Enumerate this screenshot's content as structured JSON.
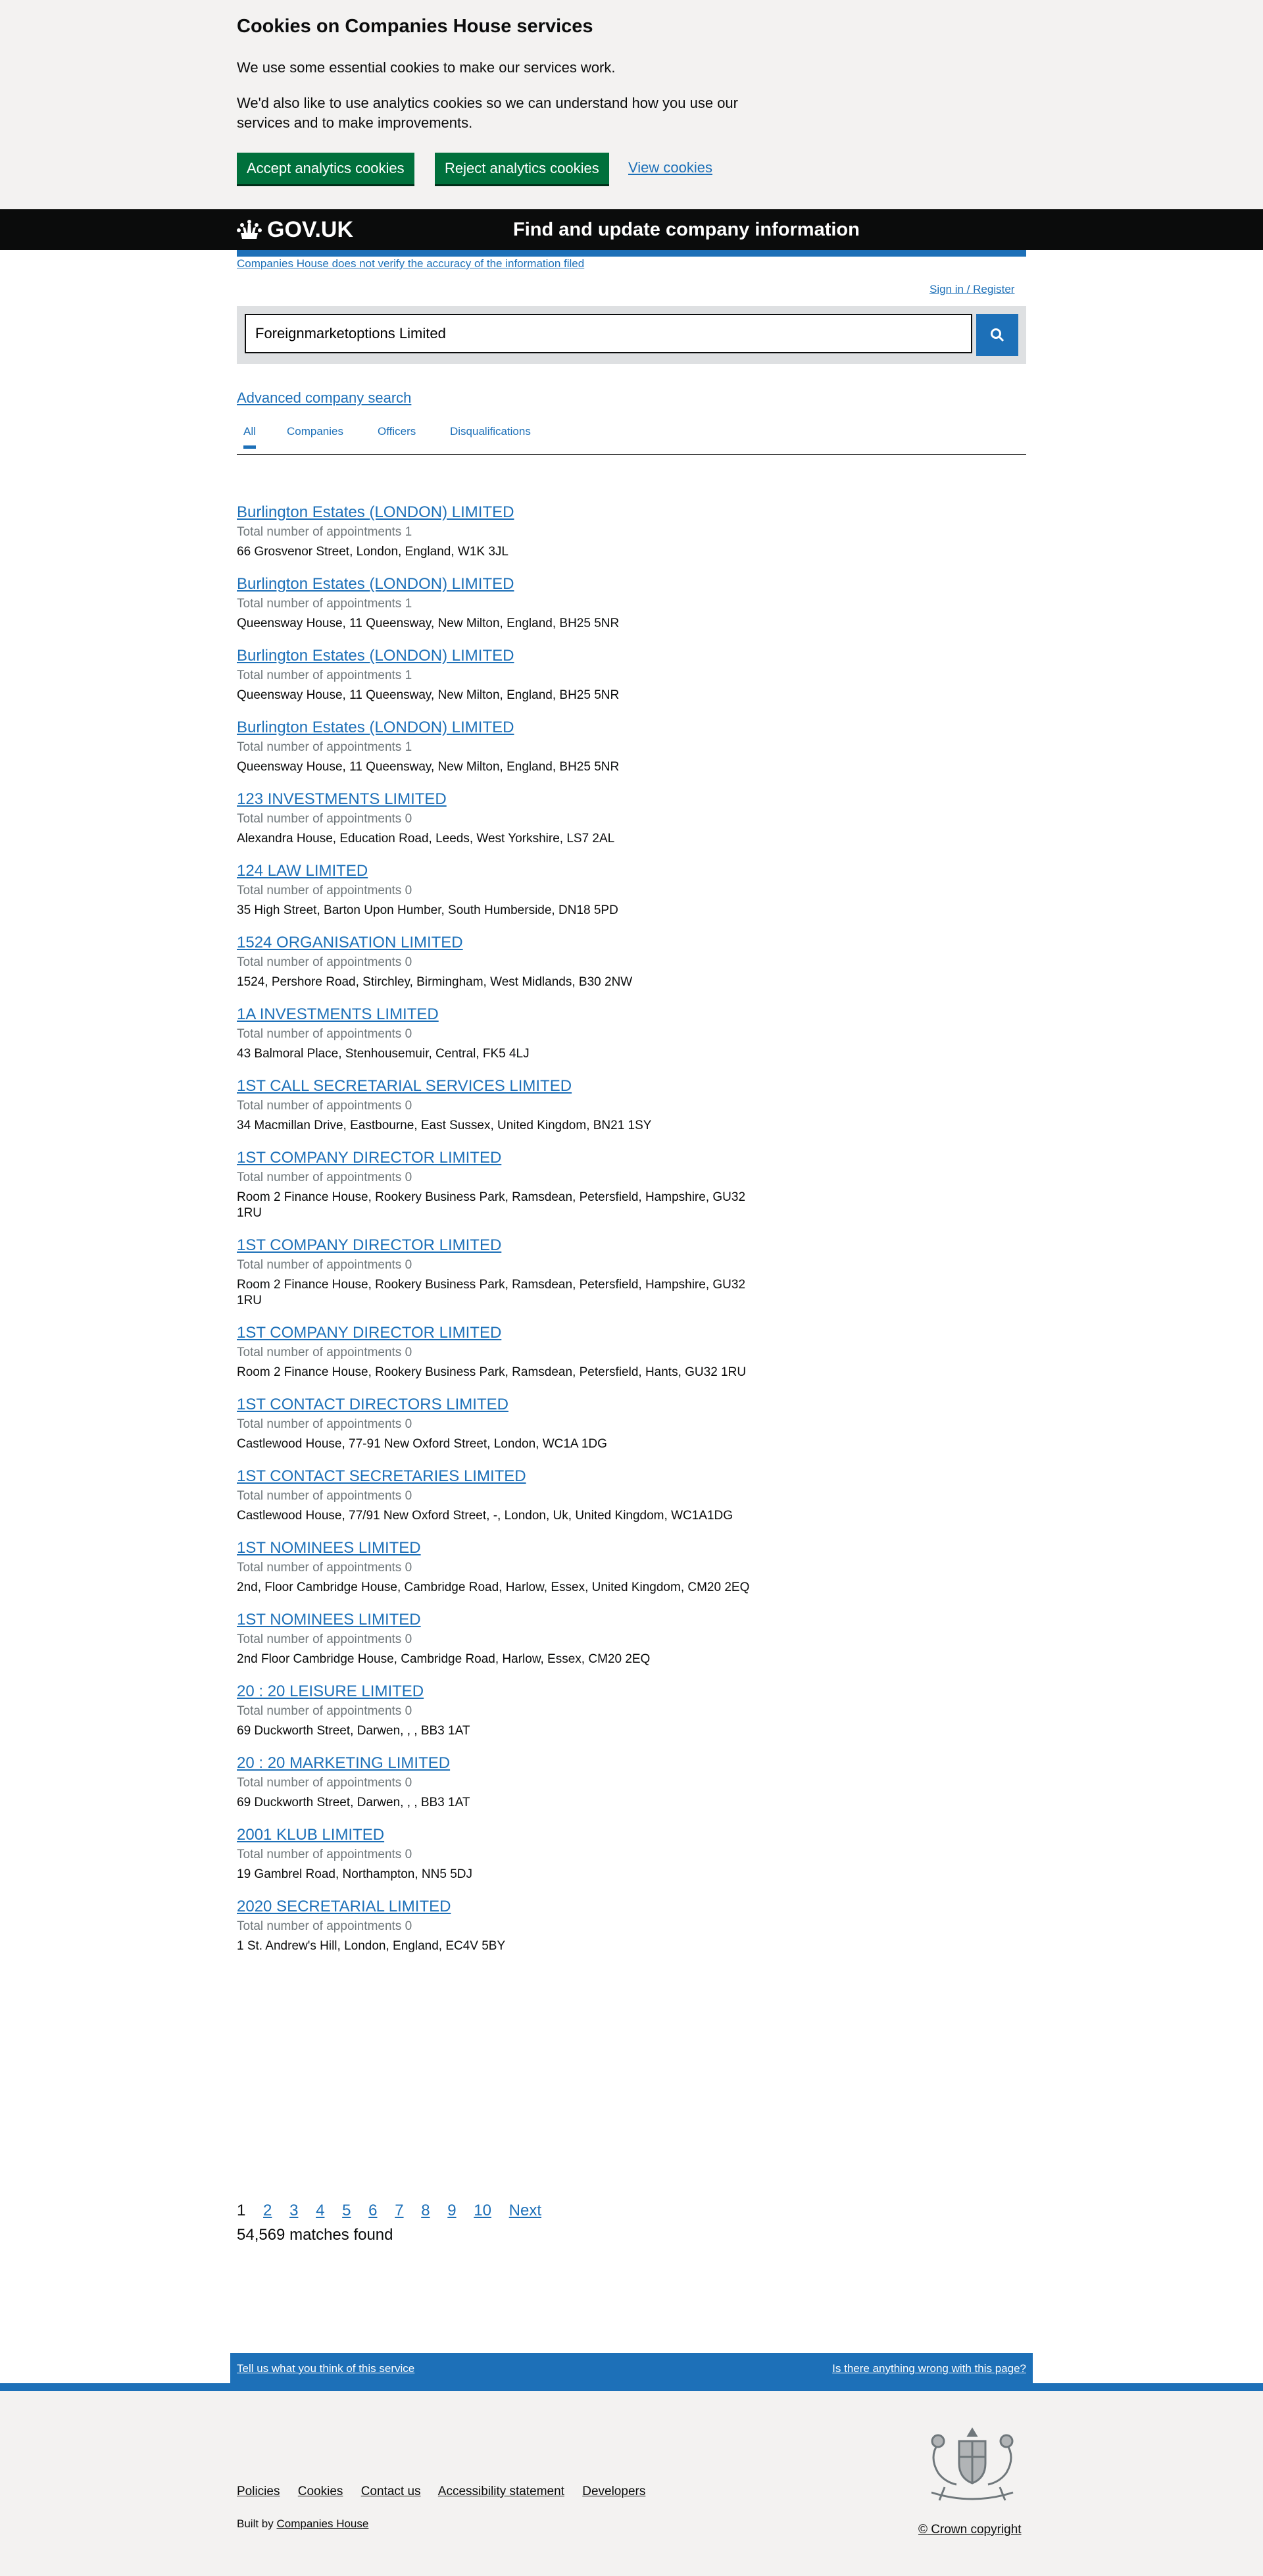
{
  "cookie_banner": {
    "title": "Cookies on Companies House services",
    "p1": "We use some essential cookies to make our services work.",
    "p2": "We'd also like to use analytics cookies so we can understand how you use our services and to make improvements.",
    "accept_label": "Accept analytics cookies",
    "reject_label": "Reject analytics cookies",
    "view_label": "View cookies"
  },
  "header": {
    "logo_text": "GOV.UK",
    "service_name": "Find and update company information"
  },
  "disclaimer": "Companies House does not verify the accuracy of the information filed",
  "signin_label": "Sign in / Register",
  "search": {
    "value": "Foreignmarketoptions Limited"
  },
  "advanced_search_label": "Advanced company search",
  "tabs": [
    "All",
    "Companies",
    "Officers",
    "Disqualifications"
  ],
  "results": [
    {
      "name": "Burlington Estates (LONDON) LIMITED",
      "appointments": "Total number of appointments 1",
      "address": "66 Grosvenor Street, London, England, W1K 3JL"
    },
    {
      "name": "Burlington Estates (LONDON) LIMITED",
      "appointments": "Total number of appointments 1",
      "address": "Queensway House, 11 Queensway, New Milton, England, BH25 5NR"
    },
    {
      "name": "Burlington Estates (LONDON) LIMITED",
      "appointments": "Total number of appointments 1",
      "address": "Queensway House, 11 Queensway, New Milton, England, BH25 5NR"
    },
    {
      "name": "Burlington Estates (LONDON) LIMITED",
      "appointments": "Total number of appointments 1",
      "address": "Queensway House, 11 Queensway, New Milton, England, BH25 5NR"
    },
    {
      "name": "123 INVESTMENTS LIMITED",
      "appointments": "Total number of appointments 0",
      "address": "Alexandra House, Education Road, Leeds, West Yorkshire, LS7 2AL"
    },
    {
      "name": "124 LAW LIMITED",
      "appointments": "Total number of appointments 0",
      "address": "35 High Street, Barton Upon Humber, South Humberside, DN18 5PD"
    },
    {
      "name": "1524 ORGANISATION LIMITED",
      "appointments": "Total number of appointments 0",
      "address": "1524, Pershore Road, Stirchley, Birmingham, West Midlands, B30 2NW"
    },
    {
      "name": "1A INVESTMENTS LIMITED",
      "appointments": "Total number of appointments 0",
      "address": "43 Balmoral Place, Stenhousemuir, Central, FK5 4LJ"
    },
    {
      "name": "1ST CALL SECRETARIAL SERVICES LIMITED",
      "appointments": "Total number of appointments 0",
      "address": "34 Macmillan Drive, Eastbourne, East Sussex, United Kingdom, BN21 1SY"
    },
    {
      "name": "1ST COMPANY DIRECTOR LIMITED",
      "appointments": "Total number of appointments 0",
      "address": "Room 2 Finance House, Rookery Business Park, Ramsdean, Petersfield, Hampshire, GU32 1RU"
    },
    {
      "name": "1ST COMPANY DIRECTOR LIMITED",
      "appointments": "Total number of appointments 0",
      "address": "Room 2 Finance House, Rookery Business Park, Ramsdean, Petersfield, Hampshire, GU32 1RU"
    },
    {
      "name": "1ST COMPANY DIRECTOR LIMITED",
      "appointments": "Total number of appointments 0",
      "address": "Room 2 Finance House, Rookery Business Park, Ramsdean, Petersfield, Hants, GU32 1RU"
    },
    {
      "name": "1ST CONTACT DIRECTORS LIMITED",
      "appointments": "Total number of appointments 0",
      "address": "Castlewood House, 77-91 New Oxford Street, London, WC1A 1DG"
    },
    {
      "name": "1ST CONTACT SECRETARIES LIMITED",
      "appointments": "Total number of appointments 0",
      "address": "Castlewood House, 77/91 New Oxford Street, -, London, Uk, United Kingdom, WC1A1DG"
    },
    {
      "name": "1ST NOMINEES LIMITED",
      "appointments": "Total number of appointments 0",
      "address": "2nd, Floor Cambridge House, Cambridge Road, Harlow, Essex, United Kingdom, CM20 2EQ"
    },
    {
      "name": "1ST NOMINEES LIMITED",
      "appointments": "Total number of appointments 0",
      "address": "2nd Floor Cambridge House, Cambridge Road, Harlow, Essex, CM20 2EQ"
    },
    {
      "name": "20 : 20 LEISURE LIMITED",
      "appointments": "Total number of appointments 0",
      "address": "69 Duckworth Street, Darwen, , , BB3 1AT"
    },
    {
      "name": "20 : 20 MARKETING LIMITED",
      "appointments": "Total number of appointments 0",
      "address": "69 Duckworth Street, Darwen, , , BB3 1AT"
    },
    {
      "name": "2001 KLUB LIMITED",
      "appointments": "Total number of appointments 0",
      "address": "19 Gambrel Road, Northampton, NN5 5DJ"
    },
    {
      "name": "2020 SECRETARIAL LIMITED",
      "appointments": "Total number of appointments 0",
      "address": "1 St. Andrew's Hill, London, England, EC4V 5BY"
    }
  ],
  "pagination": {
    "current": "1",
    "pages": [
      "2",
      "3",
      "4",
      "5",
      "6",
      "7",
      "8",
      "9",
      "10"
    ],
    "next_label": "Next"
  },
  "matches_found": "54,569 matches found",
  "feedback": {
    "left_label": "Tell us what you think of this service",
    "right_label": "Is there anything wrong with this page?"
  },
  "footer": {
    "links": [
      "Policies",
      "Cookies",
      "Contact us",
      "Accessibility statement",
      "Developers"
    ],
    "built_by_prefix": "Built by",
    "built_by_link": "Companies House",
    "copyright": "© Crown copyright"
  },
  "colors": {
    "link": "#1d70b8",
    "green_button": "#00703c",
    "header_bg": "#0b0c0c",
    "secondary_text": "#6f777b",
    "light_grey": "#f3f2f1"
  }
}
